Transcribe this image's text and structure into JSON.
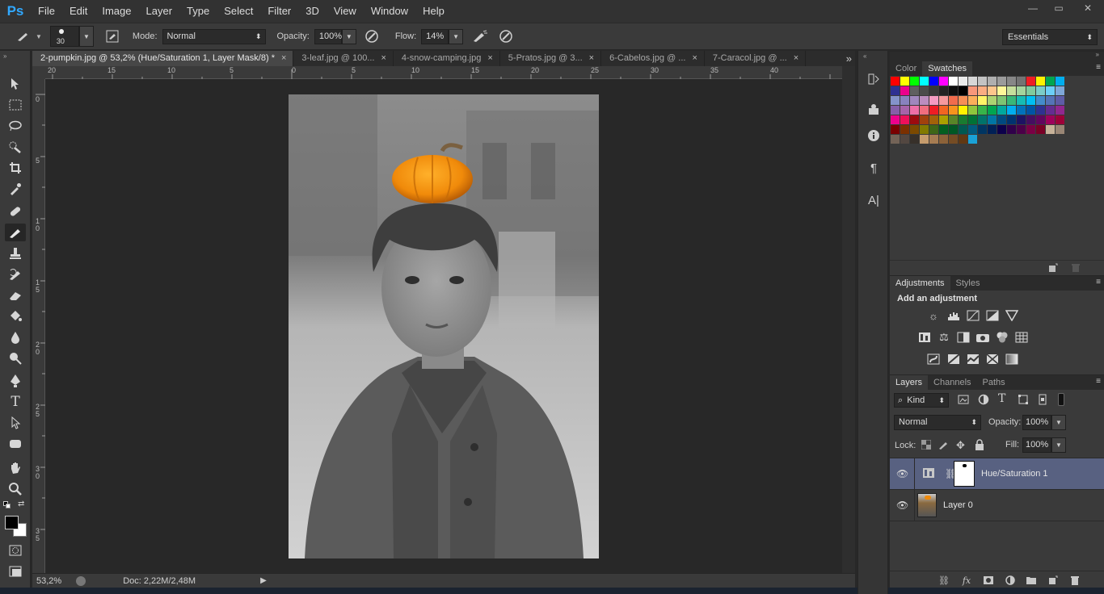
{
  "app": {
    "logo": "Ps"
  },
  "menu": [
    "File",
    "Edit",
    "Image",
    "Layer",
    "Type",
    "Select",
    "Filter",
    "3D",
    "View",
    "Window",
    "Help"
  ],
  "window_controls": {
    "minimize": "—",
    "restore": "▭",
    "close": "✕"
  },
  "options": {
    "brush_size": "30",
    "mode_label": "Mode:",
    "mode_value": "Normal",
    "opacity_label": "Opacity:",
    "opacity_value": "100%",
    "flow_label": "Flow:",
    "flow_value": "14%",
    "workspace": "Essentials"
  },
  "tabs": [
    {
      "label": "2-pumpkin.jpg @ 53,2% (Hue/Saturation 1, Layer Mask/8) *",
      "close": "×"
    },
    {
      "label": "3-leaf.jpg @ 100...",
      "close": "×"
    },
    {
      "label": "4-snow-camping.jpg",
      "close": "×"
    },
    {
      "label": "5-Pratos.jpg @ 3...",
      "close": "×"
    },
    {
      "label": "6-Cabelos.jpg @ ...",
      "close": "×"
    },
    {
      "label": "7-Caracol.jpg @ ...",
      "close": "×"
    }
  ],
  "tab_overflow": "»",
  "ruler_h": [
    "20",
    "15",
    "10",
    "5",
    "0",
    "5",
    "10",
    "15",
    "20",
    "25",
    "30",
    "35",
    "40"
  ],
  "ruler_v": [
    "0",
    "5",
    "1\n0",
    "1\n5",
    "2\n0",
    "2\n5",
    "3\n0",
    "3\n5"
  ],
  "status": {
    "zoom": "53,2%",
    "doc": "Doc: 2,22M/2,48M"
  },
  "swatch_panel": {
    "tabs": [
      "Color",
      "Swatches"
    ],
    "colors": [
      "#ff0000",
      "#ffff00",
      "#00ff00",
      "#00ffff",
      "#0000ff",
      "#ff00ff",
      "#ffffff",
      "#ebebeb",
      "#d7d7d7",
      "#c3c3c3",
      "#afafaf",
      "#9b9b9b",
      "#878787",
      "#737373",
      "#ee1d24",
      "#fff200",
      "#00a650",
      "#00aeef",
      "#2e3192",
      "#ec008c",
      "#5f5f5f",
      "#4b4b4b",
      "#373737",
      "#232323",
      "#0f0f0f",
      "#000000",
      "#f7977a",
      "#fbad82",
      "#fdc68c",
      "#fff799",
      "#c6df9c",
      "#a4d49d",
      "#81ca9d",
      "#7bcdc8",
      "#6ccff7",
      "#7ea7d8",
      "#8493ca",
      "#8882be",
      "#a187be",
      "#bc8dbf",
      "#f49bc1",
      "#f5999d",
      "#f16c4d",
      "#f68e56",
      "#fbaf5a",
      "#fff467",
      "#acd372",
      "#7dc473",
      "#39b778",
      "#16bcb4",
      "#00bff3",
      "#438ccb",
      "#5573b7",
      "#5e5ca7",
      "#855fa8",
      "#a763a9",
      "#ef6ea8",
      "#f16d7e",
      "#ee1d24",
      "#f16522",
      "#f7941d",
      "#fff200",
      "#8fc63d",
      "#37b44a",
      "#00a650",
      "#00a99e",
      "#00aeef",
      "#0072bc",
      "#0054a5",
      "#2f3192",
      "#652c91",
      "#91278f",
      "#ed008c",
      "#ee105a",
      "#9d0a0f",
      "#a1410d",
      "#a36209",
      "#aba000",
      "#588528",
      "#197b30",
      "#007236",
      "#00736a",
      "#0076a4",
      "#004a80",
      "#003370",
      "#1d1363",
      "#450e61",
      "#62055f",
      "#9e005c",
      "#9d0039",
      "#790000",
      "#7b3000",
      "#7c4900",
      "#827a00",
      "#3e6617",
      "#045f20",
      "#005824",
      "#005951",
      "#005b7e",
      "#003562",
      "#002056",
      "#0c004b",
      "#30004a",
      "#4b0048",
      "#7a0045",
      "#7a0026",
      "#c7b299",
      "#998675",
      "#736357",
      "#534741",
      "#37302a",
      "#c69c6d",
      "#a67c52",
      "#8c6239",
      "#754c24",
      "#603813",
      "#1aa1d6"
    ]
  },
  "adjustments": {
    "tabs": [
      "Adjustments",
      "Styles"
    ],
    "heading": "Add an adjustment",
    "icons": [
      [
        "brightness-icon",
        "levels-icon",
        "curves-icon",
        "exposure-icon",
        "vibrance-icon"
      ],
      [
        "hue-saturation-icon",
        "color-balance-icon",
        "black-white-icon",
        "photo-filter-icon",
        "channel-mixer-icon",
        "color-lookup-icon"
      ],
      [
        "invert-icon",
        "posterize-icon",
        "threshold-icon",
        "selective-color-icon",
        "gradient-map-icon"
      ]
    ]
  },
  "layers": {
    "tabs": [
      "Layers",
      "Channels",
      "Paths"
    ],
    "filter_kind": "Kind",
    "blend_mode": "Normal",
    "opacity_label": "Opacity:",
    "opacity_value": "100%",
    "lock_label": "Lock:",
    "fill_label": "Fill:",
    "fill_value": "100%",
    "items": [
      {
        "name": "Hue/Saturation 1",
        "selected": true
      },
      {
        "name": "Layer 0",
        "selected": false
      }
    ]
  }
}
